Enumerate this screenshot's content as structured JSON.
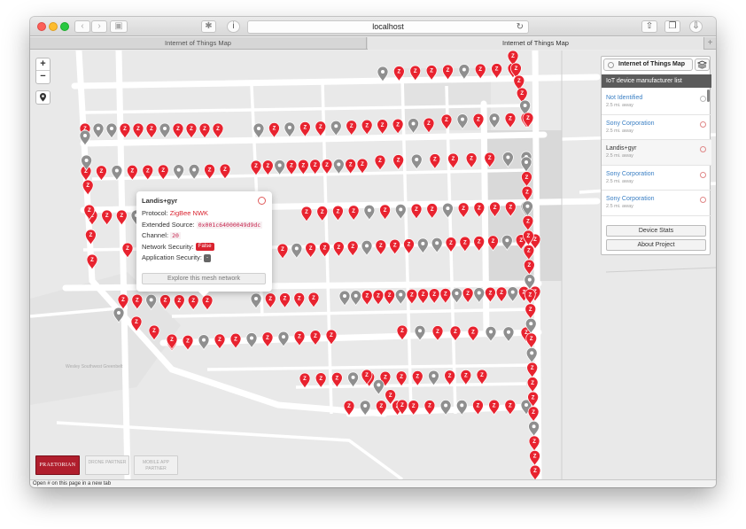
{
  "browser": {
    "address": "localhost",
    "tabs": [
      "Internet of Things Map",
      "Internet of Things Map"
    ],
    "status_text": "Open # on this page in a new tab"
  },
  "map": {
    "zoom_in_label": "+",
    "zoom_out_label": "−",
    "marker_colors": {
      "active": "#e8232f",
      "inactive": "#8f8f8f"
    },
    "marker_glyph": "Z",
    "watermark_text": "Wesley Southwest Greenbelt"
  },
  "popup": {
    "title": "Landis+gyr",
    "protocol_label": "Protocol:",
    "protocol_value": "ZigBee NWK",
    "source_label": "Extended Source:",
    "source_value": "0x001c64000049d9dc",
    "channel_label": "Channel:",
    "channel_value": "20",
    "net_sec_label": "Network Security:",
    "net_sec_value": "False",
    "app_sec_label": "Application Security:",
    "app_sec_value": "-",
    "explore_label": "Explore this mesh network"
  },
  "panel": {
    "select_label": "Internet of Things Map",
    "title": "IoT device manufacturer list",
    "items": [
      {
        "name": "Not Identified",
        "distance": "2.5 mi. away"
      },
      {
        "name": "Sony Corporation",
        "distance": "2.5 mi. away"
      },
      {
        "name": "Landis+gyr",
        "distance": "2.5 mi. away"
      },
      {
        "name": "Sony Corporation",
        "distance": "2.5 mi. away"
      },
      {
        "name": "Sony Corporation",
        "distance": "2.5 mi. away"
      }
    ],
    "device_stats_label": "Device Stats",
    "about_label": "About Project"
  },
  "footer_logos": {
    "brand": "PRAETORIAN",
    "drone": "DRONE PARTNER",
    "mobile": "MOBILE APP PARTNER"
  }
}
